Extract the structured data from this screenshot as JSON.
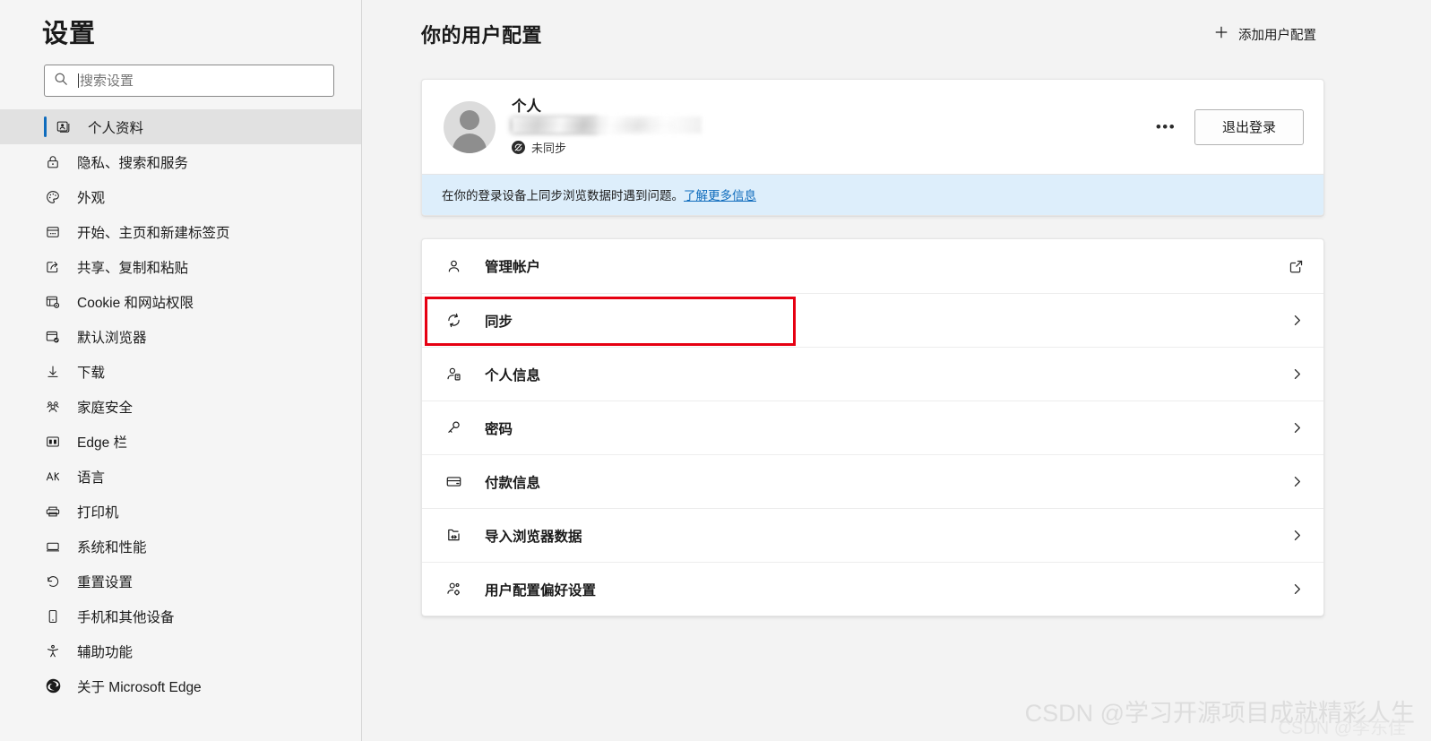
{
  "sidebar": {
    "title": "设置",
    "search": {
      "placeholder": "搜索设置",
      "value": "",
      "icon": "search-icon"
    },
    "items": [
      {
        "label": "个人资料",
        "icon": "profile-card-icon",
        "selected": true
      },
      {
        "label": "隐私、搜索和服务",
        "icon": "lock-icon",
        "selected": false
      },
      {
        "label": "外观",
        "icon": "palette-icon",
        "selected": false
      },
      {
        "label": "开始、主页和新建标签页",
        "icon": "browser-window-icon",
        "selected": false
      },
      {
        "label": "共享、复制和粘贴",
        "icon": "share-icon",
        "selected": false
      },
      {
        "label": "Cookie 和网站权限",
        "icon": "site-permissions-icon",
        "selected": false
      },
      {
        "label": "默认浏览器",
        "icon": "default-browser-check-icon",
        "selected": false
      },
      {
        "label": "下载",
        "icon": "download-arrow-icon",
        "selected": false
      },
      {
        "label": "家庭安全",
        "icon": "family-people-icon",
        "selected": false
      },
      {
        "label": "Edge 栏",
        "icon": "edge-bar-icon",
        "selected": false
      },
      {
        "label": "语言",
        "icon": "language-icon",
        "selected": false
      },
      {
        "label": "打印机",
        "icon": "printer-icon",
        "selected": false
      },
      {
        "label": "系统和性能",
        "icon": "monitor-icon",
        "selected": false
      },
      {
        "label": "重置设置",
        "icon": "reset-arrow-icon",
        "selected": false
      },
      {
        "label": "手机和其他设备",
        "icon": "phone-icon",
        "selected": false
      },
      {
        "label": "辅助功能",
        "icon": "accessibility-icon",
        "selected": false
      },
      {
        "label": "关于 Microsoft Edge",
        "icon": "edge-logo-icon",
        "selected": false
      }
    ]
  },
  "header": {
    "title": "你的用户配置",
    "add_profile_label": "添加用户配置",
    "add_profile_icon": "plus-icon"
  },
  "profile": {
    "name": "个人",
    "email": "██████████@outlook.com",
    "sync_status": "未同步",
    "sync_status_icon": "sync-off-badge-icon",
    "more_icon": "ellipsis-icon",
    "signout_label": "退出登录",
    "avatar_icon": "avatar-icon",
    "banner_text": "在你的登录设备上同步浏览数据时遇到问题。",
    "banner_link": "了解更多信息"
  },
  "list": {
    "items": [
      {
        "label": "管理帐户",
        "icon": "person-icon",
        "end": "external-link-icon",
        "highlighted": false
      },
      {
        "label": "同步",
        "icon": "sync-icon",
        "end": "chevron-right-icon",
        "highlighted": true
      },
      {
        "label": "个人信息",
        "icon": "person-info-icon",
        "end": "chevron-right-icon",
        "highlighted": false
      },
      {
        "label": "密码",
        "icon": "key-icon",
        "end": "chevron-right-icon",
        "highlighted": false
      },
      {
        "label": "付款信息",
        "icon": "credit-card-icon",
        "end": "chevron-right-icon",
        "highlighted": false
      },
      {
        "label": "导入浏览器数据",
        "icon": "import-data-icon",
        "end": "chevron-right-icon",
        "highlighted": false
      },
      {
        "label": "用户配置偏好设置",
        "icon": "person-settings-icon",
        "end": "chevron-right-icon",
        "highlighted": false
      }
    ]
  },
  "watermark": {
    "text": "CSDN @学习开源项目成就精彩人生",
    "text2": "CSDN @李东佳"
  },
  "colors": {
    "accent": "#0f6cbd",
    "highlight_box": "#e60012",
    "banner_bg": "#ddeefb",
    "sidebar_bg": "#f5f5f5",
    "card_bg": "#ffffff"
  }
}
